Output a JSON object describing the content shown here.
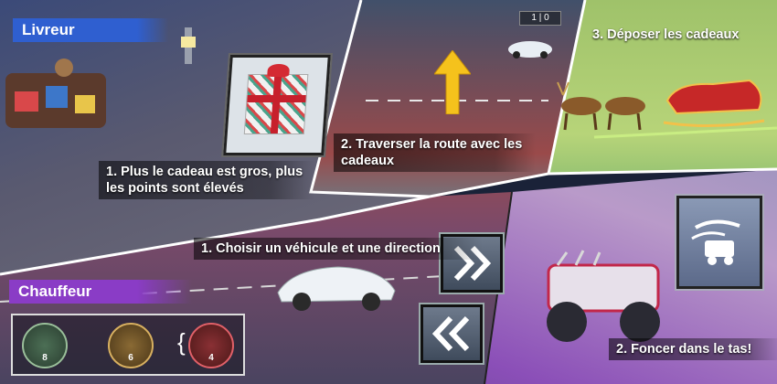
{
  "roles": {
    "livreur": "Livreur",
    "chauffeur": "Chauffeur"
  },
  "livreur_steps": {
    "step1": "1. Plus le cadeau est gros, plus les points sont élevés",
    "step2": "2. Traverser la route avec les cadeaux",
    "step3": "3. Déposer les cadeaux"
  },
  "chauffeur_steps": {
    "step1": "1. Choisir un véhicule et une direction",
    "step2": "2. Foncer dans le tas!"
  },
  "score": {
    "left": "1",
    "right": "0"
  },
  "vehicles": [
    {
      "name": "vehicle-1",
      "count": "8"
    },
    {
      "name": "vehicle-2",
      "count": "6"
    },
    {
      "name": "vehicle-3",
      "count": "4"
    }
  ],
  "colors": {
    "livreur_tag": "#2f5fd0",
    "chauffeur_tag": "#8a3cc6",
    "arrow": "#f5c21c"
  },
  "icons": {
    "gift": "gift-icon",
    "arrow_up": "arrow-up-icon",
    "chevron_right": "double-chevron-right-icon",
    "chevron_left": "double-chevron-left-icon",
    "truck_dash": "speeding-truck-icon"
  }
}
